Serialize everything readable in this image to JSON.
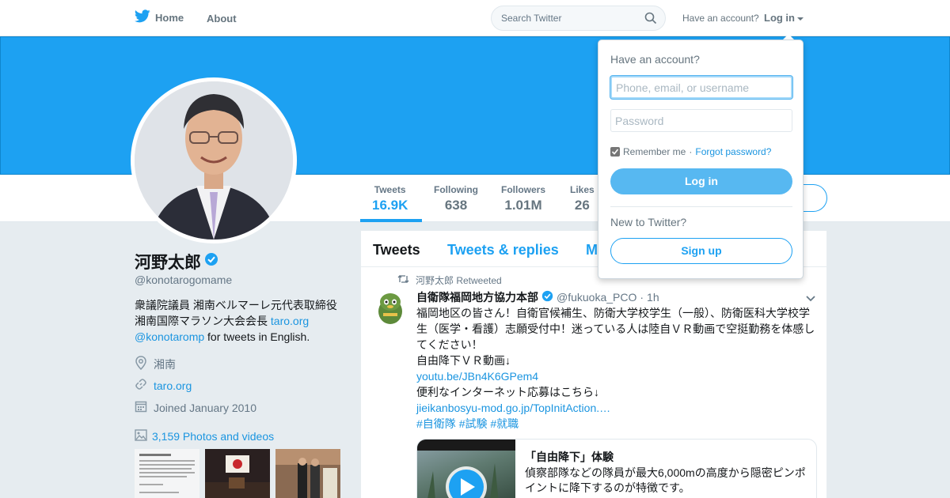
{
  "colors": {
    "brand_blue": "#1da1f2",
    "link_blue": "#1b95e0",
    "banner": "#1da1f2",
    "muted": "#657786",
    "login_button": "#57b8f1"
  },
  "nav": {
    "home_label": "Home",
    "about_label": "About",
    "search_placeholder": "Search Twitter",
    "have_account": "Have an account?",
    "login_label": "Log in",
    "icons": {
      "brand": "twitter-bird-icon",
      "search": "search-icon"
    }
  },
  "stats": [
    {
      "label": "Tweets",
      "value": "16.9K"
    },
    {
      "label": "Following",
      "value": "638"
    },
    {
      "label": "Followers",
      "value": "1.01M"
    },
    {
      "label": "Likes",
      "value": "26"
    }
  ],
  "profile": {
    "name": "河野太郎",
    "handle": "@konotarogomame",
    "bio_line1": "衆議院議員 湘南ベルマーレ元代表取締役",
    "bio_line2": "湘南国際マラソン大会会長 ",
    "bio_link1": "taro.org",
    "bio_link2": "@konotaromp",
    "bio_tail": " for tweets in English.",
    "location": "湘南",
    "website": "taro.org",
    "joined": "Joined January 2010",
    "photos_label": "3,159 Photos and videos"
  },
  "timeline": {
    "tabs": [
      "Tweets",
      "Tweets & replies",
      "M"
    ],
    "tweet": {
      "retweet_context": "河野太郎 Retweeted",
      "author": "自衛隊福岡地方協力本部",
      "handle": "@fukuoka_PCO",
      "separator": "·",
      "time": "1h",
      "text_line1": "福岡地区の皆さん！自衛官候補生、防衛大学校学生（一般）、防衛医科大学校学生（医学・看護）志願受付中！迷っている人は陸自ＶＲ動画で空挺勤務を体感してください！",
      "text_line2": "自由降下ＶＲ動画↓",
      "link1": "youtu.be/JBn4K6GPem4",
      "text_line3": "便利なインターネット応募はこちら↓",
      "link2": "jieikanbosyu-mod.go.jp/TopInitAction.…",
      "hashtags": [
        "#自衛隊",
        "#試験",
        "#就職"
      ],
      "card": {
        "title": "「自由降下」体験",
        "description": "偵察部隊などの隊員が最大6,000mの高度から隠密ピンポイントに降下するのが特徴です。"
      }
    }
  },
  "login_dropdown": {
    "heading": "Have an account?",
    "username_placeholder": "Phone, email, or username",
    "password_placeholder": "Password",
    "remember_label": "Remember me",
    "dot": " · ",
    "forgot_label": "Forgot password?",
    "login_button": "Log in",
    "new_label": "New to Twitter?",
    "signup_button": "Sign up"
  }
}
